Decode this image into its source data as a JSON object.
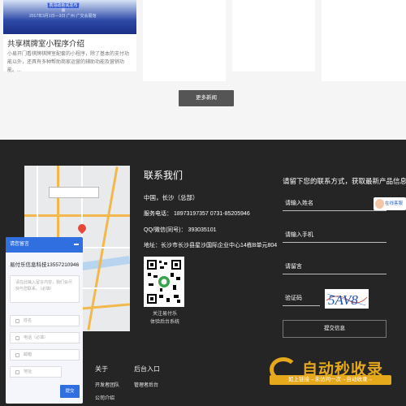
{
  "news": {
    "card": {
      "banner_button": "携领政新闻发布会",
      "banner_date": "2017年3月1日—3日 广州·广交会展馆",
      "title": "共享棋牌室小程序介绍",
      "desc": "小易开门看棋牌棋牌室配套的小程序，除了基本的支付功能以外，还具有多种帮助商家运营的辅助功能及营销功能。..."
    },
    "more_button": "更多新闻"
  },
  "contact": {
    "title": "联系我们",
    "location": "中国，长沙（总部）",
    "phone": "服务电话： 18973197357 0731-85205946",
    "qq": "QQ/微信(同号)： 393035101",
    "address": "地址：长沙市长沙县星沙国际企业中心14栋B单元804",
    "qr_caption_1": "关注易付乐",
    "qr_caption_2": "体验后台系统"
  },
  "form": {
    "heading": "请留下您的联系方式，获取最新产品信息",
    "name_placeholder": "请输入姓名",
    "phone_placeholder": "请输入手机",
    "message_placeholder": "请留言",
    "captcha_placeholder": "验证码",
    "captcha_text": "5AV8",
    "submit": "提交信息"
  },
  "online_service": "在线客服",
  "footer_cols": {
    "about_title": "关于",
    "about_item1": "开发者团队",
    "about_item2": "公司介绍",
    "admin_title": "后台入口",
    "admin_item1": "管理者后台"
  },
  "chat": {
    "header": "请您留言",
    "company": "易付乐信息科技13557210946",
    "textarea_placeholder": "请在此输入留言内容，我们会尽快与您联系。（必填）",
    "fields": [
      "姓名",
      "电话（必填）",
      "邮箱",
      "地址"
    ],
    "send": "提交"
  },
  "watermark": {
    "big": "自动秒收录",
    "small": "如上链接→未访问一次→自动收录→"
  },
  "colors": {
    "footer_bg": "#252525",
    "chat_blue": "#2f6fe0",
    "watermark": "#e7a91c"
  }
}
